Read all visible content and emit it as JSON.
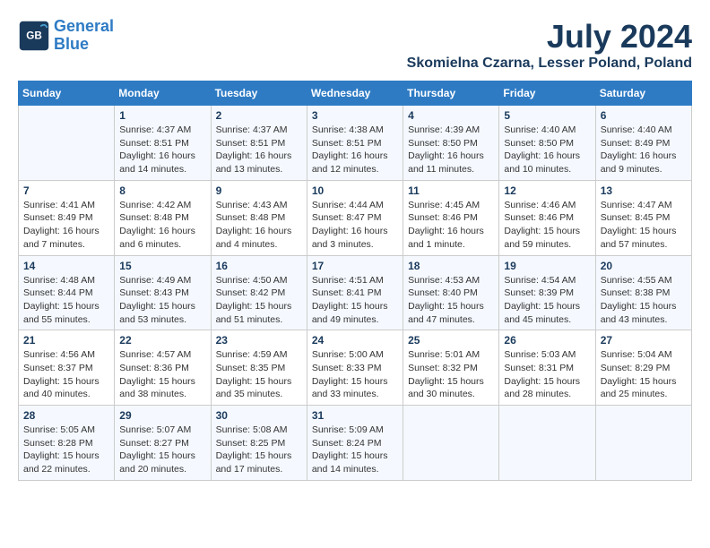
{
  "header": {
    "logo_line1": "General",
    "logo_line2": "Blue",
    "month_title": "July 2024",
    "location": "Skomielna Czarna, Lesser Poland, Poland"
  },
  "weekdays": [
    "Sunday",
    "Monday",
    "Tuesday",
    "Wednesday",
    "Thursday",
    "Friday",
    "Saturday"
  ],
  "weeks": [
    [
      {
        "day": "",
        "info": ""
      },
      {
        "day": "1",
        "info": "Sunrise: 4:37 AM\nSunset: 8:51 PM\nDaylight: 16 hours\nand 14 minutes."
      },
      {
        "day": "2",
        "info": "Sunrise: 4:37 AM\nSunset: 8:51 PM\nDaylight: 16 hours\nand 13 minutes."
      },
      {
        "day": "3",
        "info": "Sunrise: 4:38 AM\nSunset: 8:51 PM\nDaylight: 16 hours\nand 12 minutes."
      },
      {
        "day": "4",
        "info": "Sunrise: 4:39 AM\nSunset: 8:50 PM\nDaylight: 16 hours\nand 11 minutes."
      },
      {
        "day": "5",
        "info": "Sunrise: 4:40 AM\nSunset: 8:50 PM\nDaylight: 16 hours\nand 10 minutes."
      },
      {
        "day": "6",
        "info": "Sunrise: 4:40 AM\nSunset: 8:49 PM\nDaylight: 16 hours\nand 9 minutes."
      }
    ],
    [
      {
        "day": "7",
        "info": "Sunrise: 4:41 AM\nSunset: 8:49 PM\nDaylight: 16 hours\nand 7 minutes."
      },
      {
        "day": "8",
        "info": "Sunrise: 4:42 AM\nSunset: 8:48 PM\nDaylight: 16 hours\nand 6 minutes."
      },
      {
        "day": "9",
        "info": "Sunrise: 4:43 AM\nSunset: 8:48 PM\nDaylight: 16 hours\nand 4 minutes."
      },
      {
        "day": "10",
        "info": "Sunrise: 4:44 AM\nSunset: 8:47 PM\nDaylight: 16 hours\nand 3 minutes."
      },
      {
        "day": "11",
        "info": "Sunrise: 4:45 AM\nSunset: 8:46 PM\nDaylight: 16 hours\nand 1 minute."
      },
      {
        "day": "12",
        "info": "Sunrise: 4:46 AM\nSunset: 8:46 PM\nDaylight: 15 hours\nand 59 minutes."
      },
      {
        "day": "13",
        "info": "Sunrise: 4:47 AM\nSunset: 8:45 PM\nDaylight: 15 hours\nand 57 minutes."
      }
    ],
    [
      {
        "day": "14",
        "info": "Sunrise: 4:48 AM\nSunset: 8:44 PM\nDaylight: 15 hours\nand 55 minutes."
      },
      {
        "day": "15",
        "info": "Sunrise: 4:49 AM\nSunset: 8:43 PM\nDaylight: 15 hours\nand 53 minutes."
      },
      {
        "day": "16",
        "info": "Sunrise: 4:50 AM\nSunset: 8:42 PM\nDaylight: 15 hours\nand 51 minutes."
      },
      {
        "day": "17",
        "info": "Sunrise: 4:51 AM\nSunset: 8:41 PM\nDaylight: 15 hours\nand 49 minutes."
      },
      {
        "day": "18",
        "info": "Sunrise: 4:53 AM\nSunset: 8:40 PM\nDaylight: 15 hours\nand 47 minutes."
      },
      {
        "day": "19",
        "info": "Sunrise: 4:54 AM\nSunset: 8:39 PM\nDaylight: 15 hours\nand 45 minutes."
      },
      {
        "day": "20",
        "info": "Sunrise: 4:55 AM\nSunset: 8:38 PM\nDaylight: 15 hours\nand 43 minutes."
      }
    ],
    [
      {
        "day": "21",
        "info": "Sunrise: 4:56 AM\nSunset: 8:37 PM\nDaylight: 15 hours\nand 40 minutes."
      },
      {
        "day": "22",
        "info": "Sunrise: 4:57 AM\nSunset: 8:36 PM\nDaylight: 15 hours\nand 38 minutes."
      },
      {
        "day": "23",
        "info": "Sunrise: 4:59 AM\nSunset: 8:35 PM\nDaylight: 15 hours\nand 35 minutes."
      },
      {
        "day": "24",
        "info": "Sunrise: 5:00 AM\nSunset: 8:33 PM\nDaylight: 15 hours\nand 33 minutes."
      },
      {
        "day": "25",
        "info": "Sunrise: 5:01 AM\nSunset: 8:32 PM\nDaylight: 15 hours\nand 30 minutes."
      },
      {
        "day": "26",
        "info": "Sunrise: 5:03 AM\nSunset: 8:31 PM\nDaylight: 15 hours\nand 28 minutes."
      },
      {
        "day": "27",
        "info": "Sunrise: 5:04 AM\nSunset: 8:29 PM\nDaylight: 15 hours\nand 25 minutes."
      }
    ],
    [
      {
        "day": "28",
        "info": "Sunrise: 5:05 AM\nSunset: 8:28 PM\nDaylight: 15 hours\nand 22 minutes."
      },
      {
        "day": "29",
        "info": "Sunrise: 5:07 AM\nSunset: 8:27 PM\nDaylight: 15 hours\nand 20 minutes."
      },
      {
        "day": "30",
        "info": "Sunrise: 5:08 AM\nSunset: 8:25 PM\nDaylight: 15 hours\nand 17 minutes."
      },
      {
        "day": "31",
        "info": "Sunrise: 5:09 AM\nSunset: 8:24 PM\nDaylight: 15 hours\nand 14 minutes."
      },
      {
        "day": "",
        "info": ""
      },
      {
        "day": "",
        "info": ""
      },
      {
        "day": "",
        "info": ""
      }
    ]
  ]
}
